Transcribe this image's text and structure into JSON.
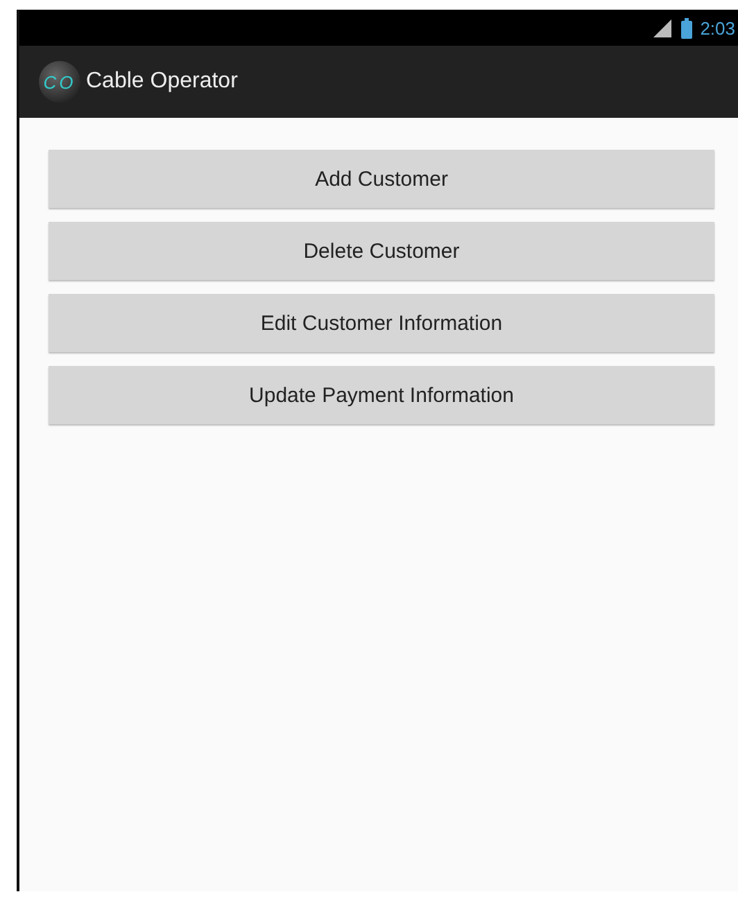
{
  "status_bar": {
    "time": "2:03"
  },
  "action_bar": {
    "logo_text": "CO",
    "title": "Cable Operator"
  },
  "buttons": [
    {
      "label": "Add Customer"
    },
    {
      "label": "Delete Customer"
    },
    {
      "label": "Edit Customer Information"
    },
    {
      "label": "Update Payment Information"
    }
  ]
}
